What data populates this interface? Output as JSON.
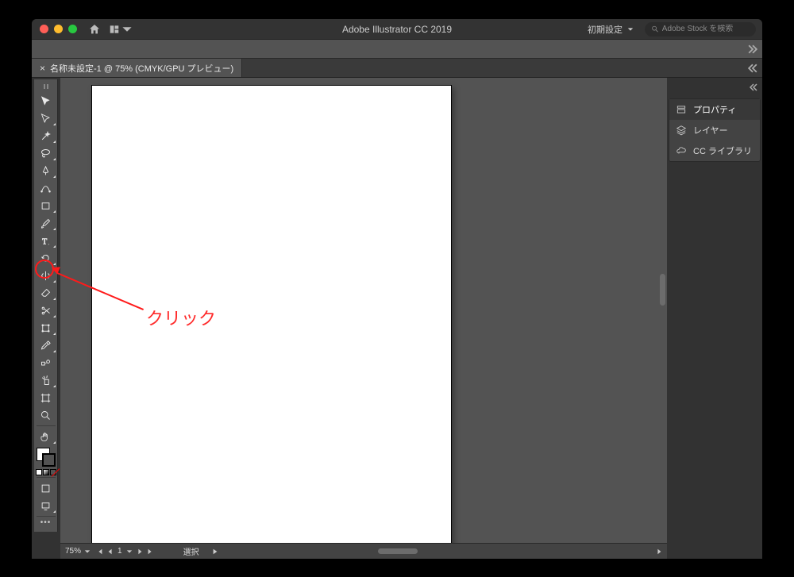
{
  "app": {
    "title": "Adobe Illustrator CC 2019",
    "workspace_label": "初期設定",
    "search_placeholder": "Adobe Stock を検索"
  },
  "document": {
    "tab_label": "名称未設定-1 @ 75% (CMYK/GPU プレビュー)"
  },
  "statusbar": {
    "zoom": "75%",
    "artboard_index": "1",
    "selection_label": "選択"
  },
  "right_panel": {
    "items": [
      {
        "id": "properties",
        "label": "プロパティ"
      },
      {
        "id": "layers",
        "label": "レイヤー"
      },
      {
        "id": "libraries",
        "label": "CC ライブラリ"
      }
    ],
    "active": "properties"
  },
  "tools": [
    {
      "id": "selection",
      "name": "選択ツール",
      "flyout": false
    },
    {
      "id": "direct-selection",
      "name": "ダイレクト選択ツール",
      "flyout": true
    },
    {
      "id": "magic-wand",
      "name": "自動選択ツール",
      "flyout": true
    },
    {
      "id": "lasso",
      "name": "なげなわツール",
      "flyout": true
    },
    {
      "id": "pen",
      "name": "ペンツール",
      "flyout": true
    },
    {
      "id": "curvature",
      "name": "曲線ツール",
      "flyout": false
    },
    {
      "id": "rectangle",
      "name": "長方形ツール",
      "flyout": true
    },
    {
      "id": "paintbrush",
      "name": "ブラシツール",
      "flyout": true
    },
    {
      "id": "type",
      "name": "文字ツール",
      "flyout": true
    },
    {
      "id": "rotate",
      "name": "回転ツール",
      "flyout": true
    },
    {
      "id": "reflect",
      "name": "リフレクトツール",
      "flyout": true
    },
    {
      "id": "eraser",
      "name": "消しゴムツール",
      "flyout": true
    },
    {
      "id": "scissors",
      "name": "はさみツール",
      "flyout": true
    },
    {
      "id": "free-transform",
      "name": "自由変形ツール",
      "flyout": true
    },
    {
      "id": "eyedropper",
      "name": "スポイトツール",
      "flyout": true
    },
    {
      "id": "blend",
      "name": "ブレンドツール",
      "flyout": false
    },
    {
      "id": "symbol-sprayer",
      "name": "シンボルスプレーツール",
      "flyout": true
    },
    {
      "id": "artboard",
      "name": "アートボードツール",
      "flyout": false
    },
    {
      "id": "zoom",
      "name": "ズームツール",
      "flyout": false
    },
    {
      "id": "hand",
      "name": "手のひらツール",
      "flyout": true
    }
  ],
  "annotation": {
    "label": "クリック",
    "target_tool": "artboard"
  },
  "colors": {
    "anno_red": "#ff1a1a",
    "panel_bg": "#434343",
    "ui_bg": "#535353",
    "app_bg": "#323232"
  }
}
